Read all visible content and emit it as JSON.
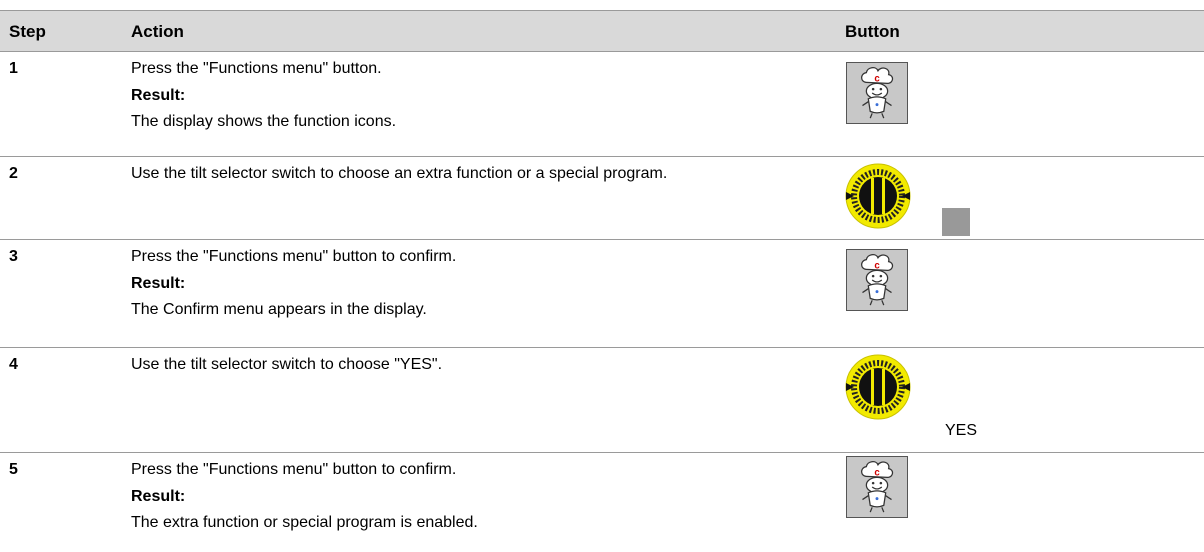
{
  "header": {
    "step": "Step",
    "action": "Action",
    "button": "Button"
  },
  "rows": [
    {
      "step": "1",
      "action": "Press the \"Functions menu\" button.",
      "result_label": "Result:",
      "result": "The display shows the function icons.",
      "button_icon": "functions-menu-chef-icon"
    },
    {
      "step": "2",
      "action": "Use the tilt selector switch to choose an extra function or a special program.",
      "button_icon": "tilt-selector-dial-icon",
      "button_extra": "gray-square"
    },
    {
      "step": "3",
      "action": "Press the \"Functions menu\" button to confirm.",
      "result_label": "Result:",
      "result": "The Confirm menu appears in the display.",
      "button_icon": "functions-menu-chef-icon"
    },
    {
      "step": "4",
      "action": "Use the tilt selector switch to choose \"YES\".",
      "button_icon": "tilt-selector-dial-icon",
      "button_text": "YES"
    },
    {
      "step": "5",
      "action": "Press the \"Functions menu\" button to confirm.",
      "result_label": "Result:",
      "result": "The extra function or special program is enabled.",
      "button_icon": "functions-menu-chef-icon"
    }
  ],
  "colors": {
    "header_bg": "#d9d9d9",
    "dial_yellow": "#f2ea00",
    "dial_dark": "#222222",
    "button_gray": "#c8c8c8"
  }
}
